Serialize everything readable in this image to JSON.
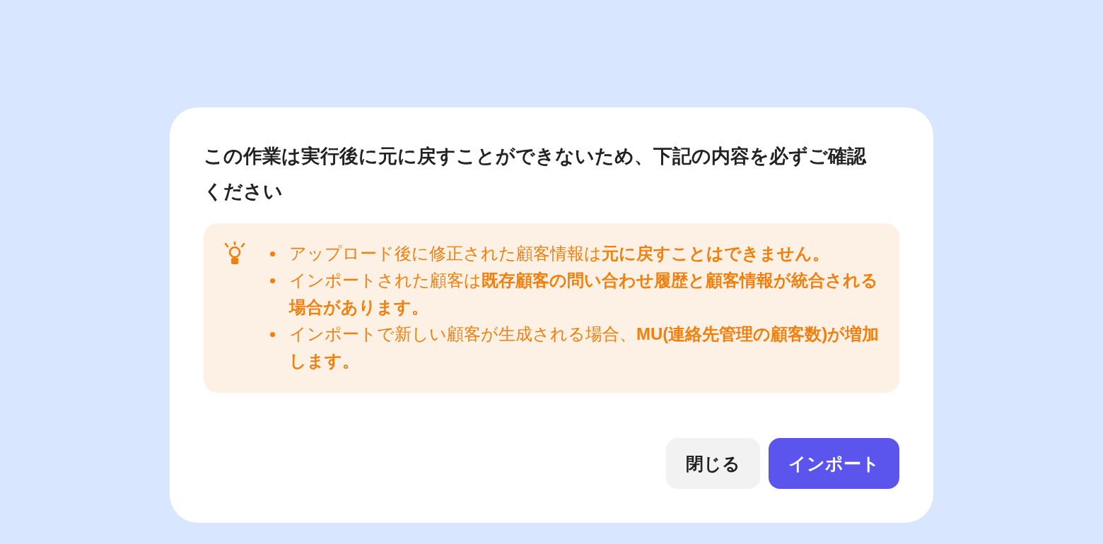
{
  "dialog": {
    "title": "この作業は実行後に元に戻すことができないため、下記の内容を必ずご確認ください",
    "notice": {
      "items": [
        "アップロード後に修正された顧客情報は**元に戻すことはできません。**",
        "インポートされた顧客は**既存顧客の問い合わせ履歴と顧客情報が統合される場合があります。**",
        "インポートで新しい顧客が生成される場合、**MU(連絡先管理の顧客数)が増加します。**"
      ]
    },
    "buttons": [
      {
        "label": "閉じる",
        "kind": "secondary"
      },
      {
        "label": "インポート",
        "kind": "primary"
      }
    ]
  }
}
